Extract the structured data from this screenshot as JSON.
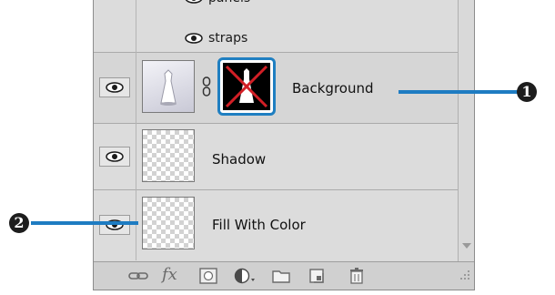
{
  "layers_panel": {
    "effects": [
      {
        "label": "panels",
        "icon": "eye-icon"
      },
      {
        "label": "straps",
        "icon": "eye-icon"
      }
    ],
    "layers": [
      {
        "name": "Background",
        "visible": true,
        "has_mask": true,
        "thumbnail": "dress-photo"
      },
      {
        "name": "Shadow",
        "visible": true,
        "thumbnail": "transparent-checker"
      },
      {
        "name": "Fill With Color",
        "visible": true,
        "thumbnail": "transparent-checker"
      }
    ],
    "toolbar_icons": [
      "link-layers-icon",
      "fx-icon",
      "add-mask-icon",
      "adjustment-layer-icon",
      "new-group-icon",
      "new-layer-icon",
      "trash-icon"
    ],
    "fx_label": "fx"
  },
  "callouts": [
    {
      "number": "1",
      "color": "#1e7cc2"
    },
    {
      "number": "2",
      "color": "#1e7cc2"
    }
  ]
}
